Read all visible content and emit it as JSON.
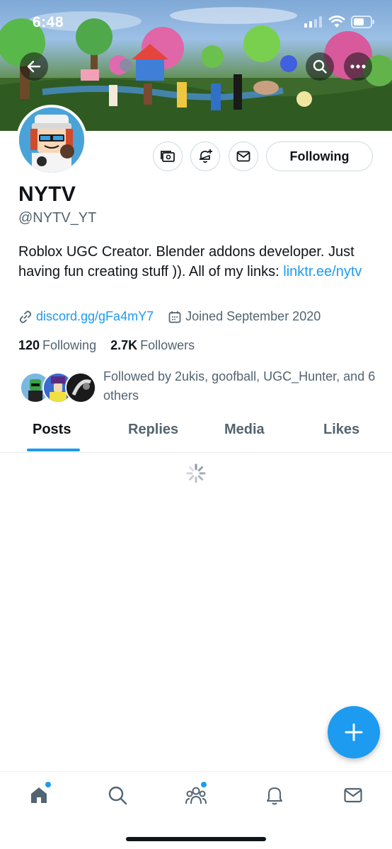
{
  "status_bar": {
    "time": "6:48"
  },
  "profile": {
    "display_name": "NYTV",
    "handle": "@NYTV_YT",
    "bio_text": "Roblox UGC Creator. Blender addons developer. Just having fun creating stuff )). All of my links: ",
    "bio_link": "linktr.ee/nytv",
    "website": "discord.gg/gFa4mY7",
    "joined": "Joined September 2020",
    "following_count": "120",
    "following_label": "Following",
    "followers_count": "2.7K",
    "followers_label": "Followers",
    "followed_by": "Followed by 2ukis, goofball, UGC_Hunter, and 6 others"
  },
  "actions": {
    "following_button": "Following"
  },
  "tabs": [
    {
      "label": "Posts",
      "active": true
    },
    {
      "label": "Replies",
      "active": false
    },
    {
      "label": "Media",
      "active": false
    },
    {
      "label": "Likes",
      "active": false
    }
  ],
  "icons": {
    "back": "back-arrow-icon",
    "search": "search-icon",
    "more": "more-icon",
    "subscribe": "subscription-icon",
    "notify": "notification-bell-plus-icon",
    "message": "envelope-icon",
    "link": "link-icon",
    "calendar": "calendar-icon",
    "compose": "plus-icon",
    "nav": [
      "home-icon",
      "search-icon",
      "communities-icon",
      "bell-icon",
      "envelope-icon"
    ]
  },
  "colors": {
    "accent": "#1d9bf0",
    "text": "#0f1419",
    "muted": "#536471"
  }
}
